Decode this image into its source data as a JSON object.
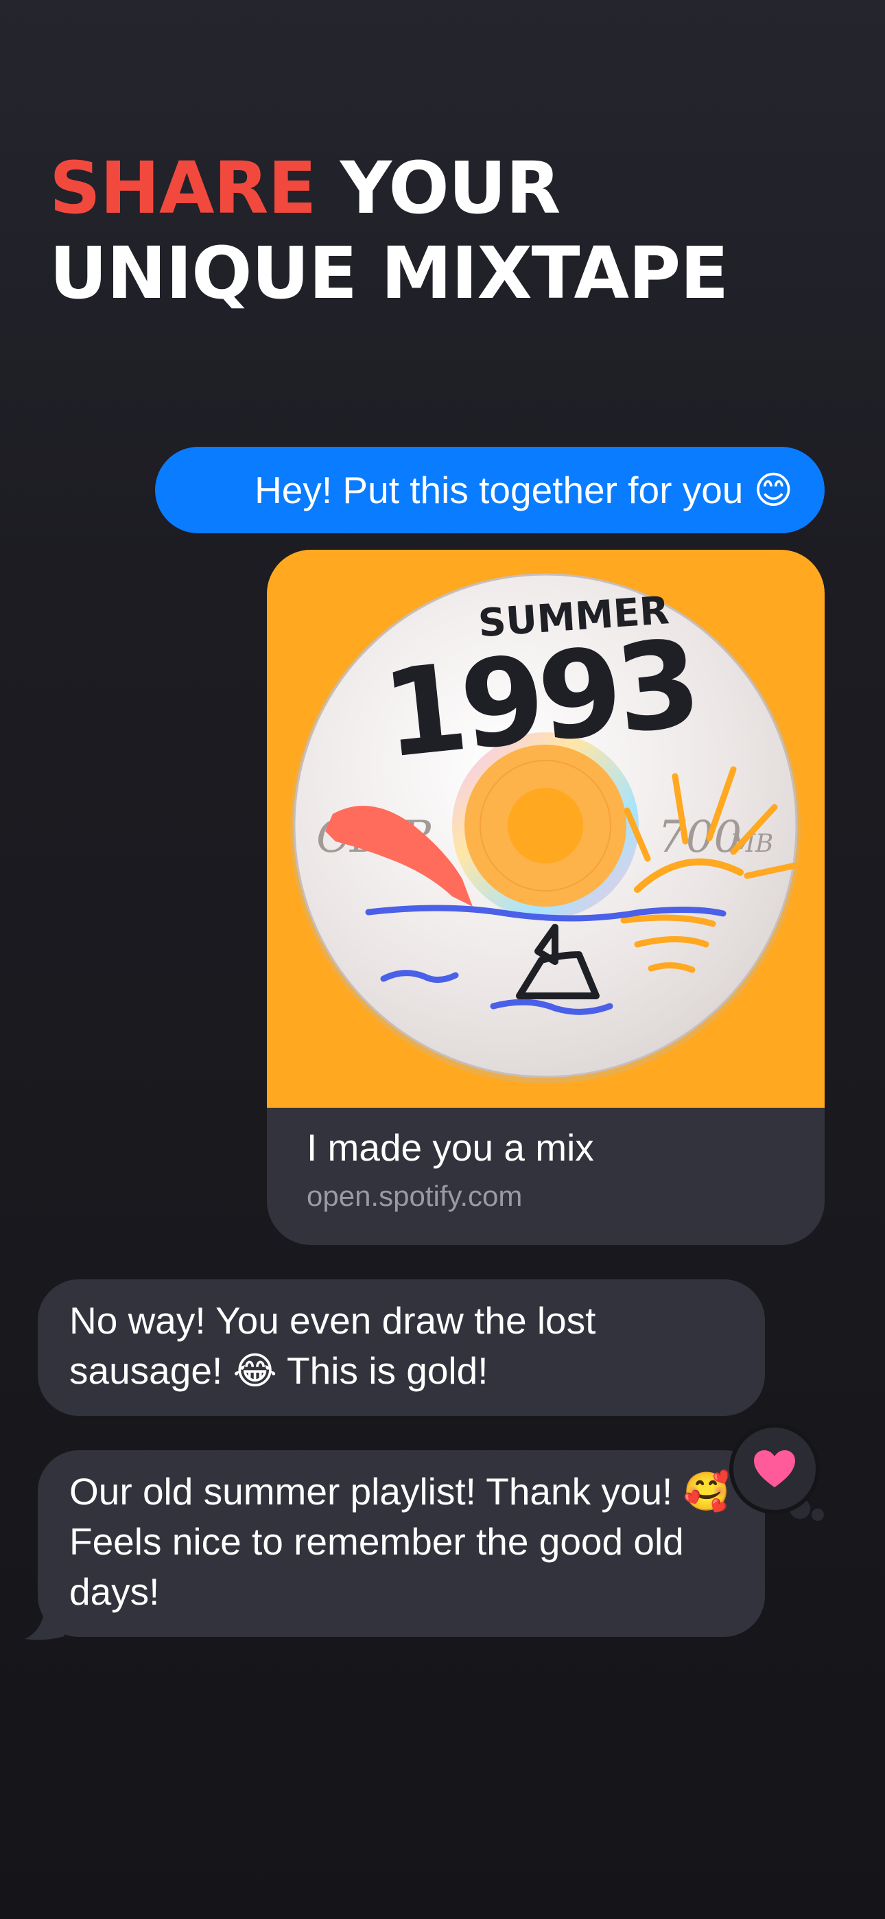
{
  "headline": {
    "accent": "SHARE",
    "rest": "YOUR",
    "line2": "UNIQUE MIXTAPE"
  },
  "colors": {
    "accent": "#f2493e",
    "outgoing_bubble": "#0a7cff",
    "incoming_bubble": "#33333d",
    "artwork_bg": "#ffa820",
    "heart": "#ff5a9a"
  },
  "chat": {
    "outgoing_message": "Hey! Put this together for you 😊",
    "link_preview": {
      "artwork": {
        "doodle_text": "SUMMER",
        "year": "1993",
        "disc_label": "CD-R",
        "capacity": "700",
        "capacity_unit": "MB"
      },
      "title": "I made you a mix",
      "domain": "open.spotify.com"
    },
    "incoming_message_1": "No way! You even draw the lost sausage! 😂 This is gold!",
    "incoming_message_2": "Our old summer playlist! Thank you! 🥰 Feels nice to remember the good old days!",
    "reaction": {
      "icon": "heart-icon"
    }
  }
}
